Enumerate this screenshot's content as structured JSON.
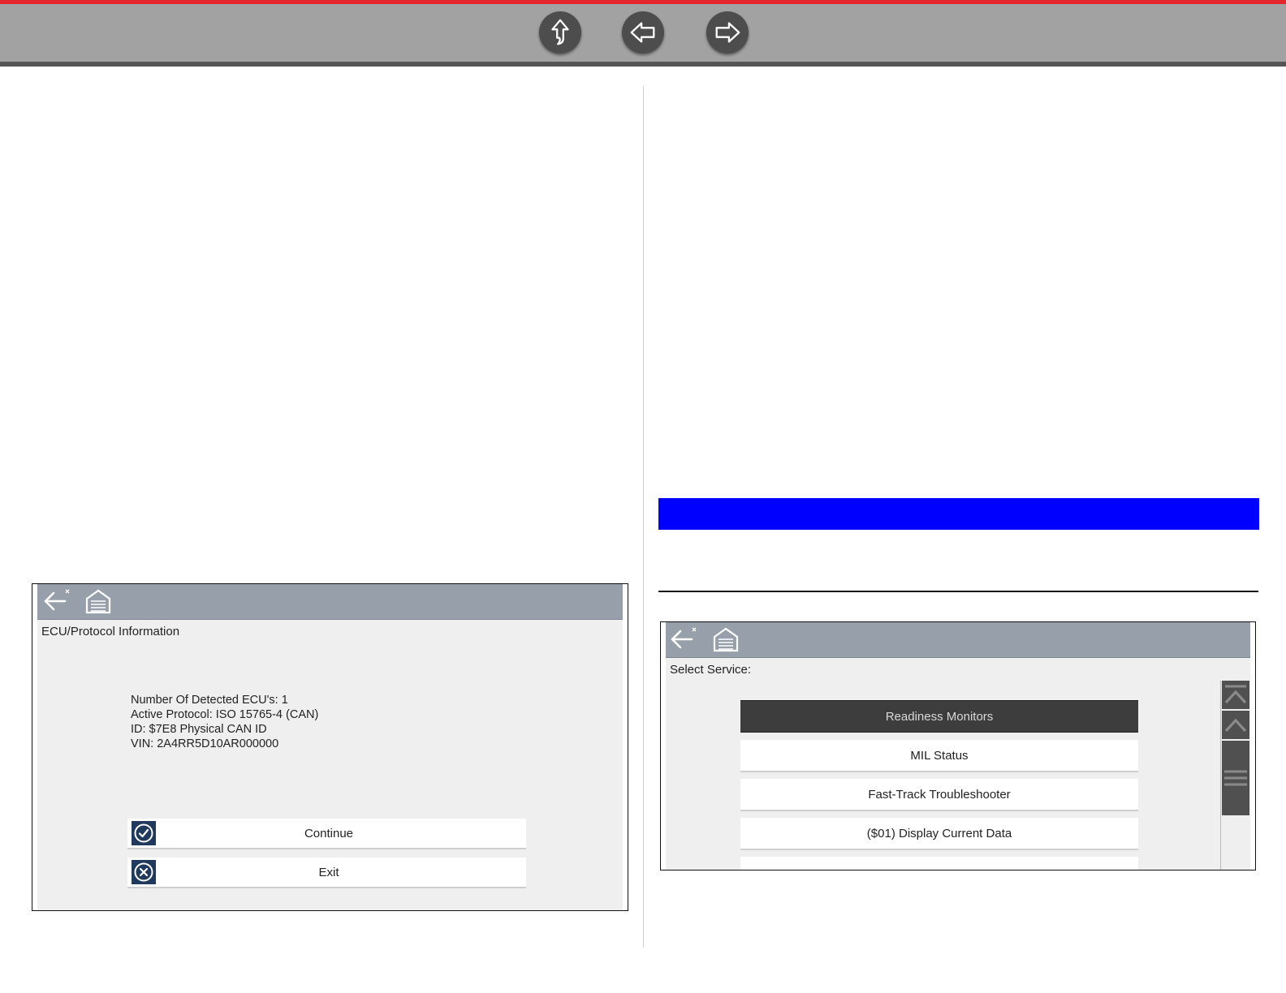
{
  "nav": {
    "up": "up-arrow-icon",
    "back": "left-arrow-icon",
    "forward": "right-arrow-icon"
  },
  "colors": {
    "accent_red": "#e3262e",
    "toolbar_gray": "#97a0aa",
    "highlight_blue": "#0000ff",
    "button_icon_navy": "#1f3a5c"
  },
  "ecu_screen": {
    "toolbar_icons": [
      "back-exit-icon",
      "home-garage-icon"
    ],
    "title": "ECU/Protocol Information",
    "info_lines": [
      "Number Of Detected ECU's: 1",
      "Active Protocol: ISO 15765-4 (CAN)",
      "ID: $7E8 Physical CAN ID",
      "VIN: 2A4RR5D10AR000000"
    ],
    "buttons": [
      {
        "label": "Continue",
        "icon": "check-circle-icon"
      },
      {
        "label": "Exit",
        "icon": "x-circle-icon"
      }
    ]
  },
  "service_screen": {
    "toolbar_icons": [
      "back-exit-icon",
      "home-garage-icon"
    ],
    "title": "Select Service:",
    "items": [
      {
        "label": "Readiness Monitors",
        "selected": true
      },
      {
        "label": "MIL Status",
        "selected": false
      },
      {
        "label": "Fast-Track Troubleshooter",
        "selected": false
      },
      {
        "label": "($01) Display Current Data",
        "selected": false
      },
      {
        "label": "",
        "selected": false
      }
    ],
    "scroll_icons": [
      "scroll-top-icon",
      "scroll-up-icon",
      "scroll-thumb-icon"
    ]
  }
}
